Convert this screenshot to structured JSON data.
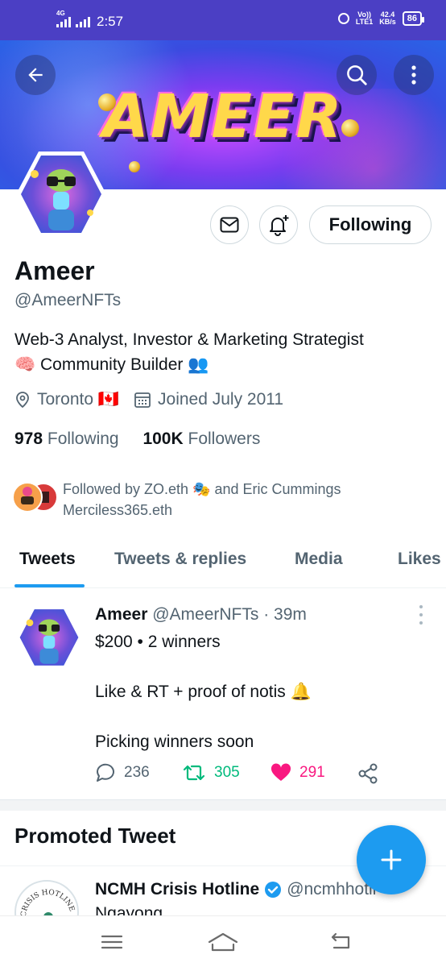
{
  "status_bar": {
    "network_tag": "4G",
    "time": "2:57",
    "volte": "Vo))",
    "lte": "LTE1",
    "speed_value": "42.4",
    "speed_unit": "KB/s",
    "battery": "86",
    "icons": [
      "signal-icon",
      "alarm-icon",
      "battery-icon"
    ]
  },
  "banner": {
    "text": "AMEER",
    "icons": [
      "back-arrow-icon",
      "search-icon",
      "more-vertical-icon"
    ]
  },
  "profile": {
    "name": "Ameer",
    "handle": "@AmeerNFTs",
    "bio_line1": "Web-3 Analyst, Investor & Marketing Strategist",
    "bio_line2": "🧠 Community Builder 👥",
    "location": "Toronto 🇨🇦",
    "joined": "Joined July 2011",
    "following_count": "978",
    "following_label": "Following",
    "followers_count": "100K",
    "followers_label": "Followers",
    "follow_button_label": "Following",
    "followed_by_line1": "Followed by ZO.eth 🎭 and Eric Cummings",
    "followed_by_line2": "Merciless365.eth"
  },
  "tabs": [
    {
      "label": "Tweets",
      "active": true
    },
    {
      "label": "Tweets & replies",
      "active": false
    },
    {
      "label": "Media",
      "active": false
    },
    {
      "label": "Likes",
      "active": false
    }
  ],
  "tweet": {
    "author_name": "Ameer",
    "author_handle": "@AmeerNFTs",
    "time": "· 39m",
    "line1": "$200 • 2 winners",
    "line2": "Like & RT + proof of notis 🔔",
    "line3": "Picking winners soon",
    "replies": "236",
    "retweets": "305",
    "likes": "291"
  },
  "promoted": {
    "section_title": "Promoted Tweet",
    "author_name": "NCMH Crisis Hotline",
    "author_handle": "@ncmhhotli",
    "text": "Ngayong",
    "logo_text": "CRISIS HOTLINE"
  },
  "colors": {
    "accent": "#1d9bf0",
    "retweet": "#00ba7c",
    "like": "#f91880",
    "status_bar": "#4b3fc4"
  }
}
